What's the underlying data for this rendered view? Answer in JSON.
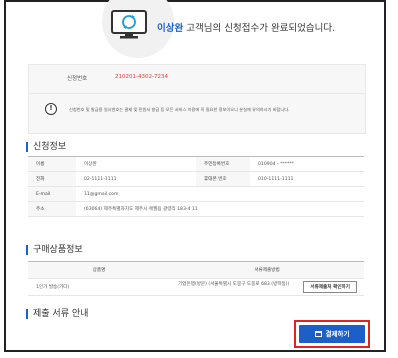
{
  "header": {
    "customer_name": "이상완",
    "message": " 고객님의 신청접수가 완료되었습니다."
  },
  "application": {
    "number_label": "신청번호",
    "number_value": "210201-4302-7234",
    "notice": "신청번호 및 발급용 일시번호는 결제 및 민원서 발급 등 모든 서비스 이용에 꼭 필요한 정보이오니 분실에 유의하시기 바랍니다."
  },
  "applicant_section": {
    "title": "신청정보",
    "rows": [
      {
        "label": "이름",
        "value": "이상완",
        "label2": "주민등록번호",
        "value2": "010904 - ******"
      },
      {
        "label": "전화",
        "value": "02-1111-1111",
        "label2": "휴대폰 번호",
        "value2": "010-1111-1111"
      },
      {
        "label": "E-mail",
        "value": "11@gmail.com"
      },
      {
        "label": "주소",
        "value": "(63064) 제주특별자치도 제주시 애월읍 광령리 183-4 11"
      }
    ]
  },
  "goods_section": {
    "title": "구매상품정보",
    "col1": "상품명",
    "col2": "서류제출방법",
    "row_name": "1인가 발송(가다)",
    "row_method": "기업은행(방문) (서울특별시 도봉구 도봉로 683 (방학동))",
    "doc_button": "서류제출처 확인하기"
  },
  "docs_section": {
    "title": "제출 서류 안내"
  },
  "pay_button": "결제하기",
  "colors": {
    "accent": "#1d5fc9",
    "highlight": "#e02222",
    "number": "#e4403a"
  },
  "icons": [
    "monitor-refresh-icon",
    "exclamation-icon",
    "card-icon"
  ]
}
